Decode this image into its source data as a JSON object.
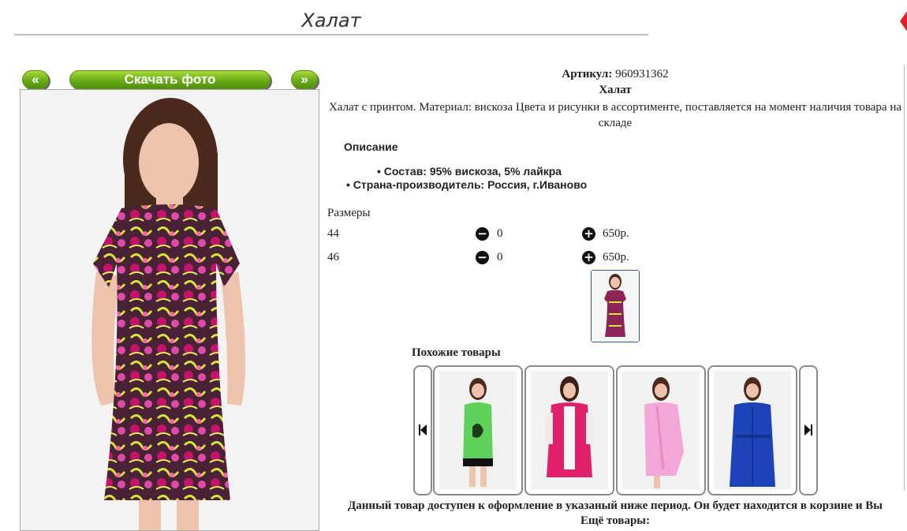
{
  "page_title": "Халат",
  "buttons": {
    "prev": "«",
    "download": "Скачать фото",
    "next": "»"
  },
  "product": {
    "sku_label": "Артикул:",
    "sku_value": "960931362",
    "name": "Халат",
    "description": "Халат с принтом. Материал: вискоза Цвета и рисунки в ассортименте, поставляется на момент наличия товара на складе"
  },
  "description_section": {
    "heading": "Описание",
    "features": [
      "Состав: 95% вискоза, 5% лайкра",
      "Страна-производитель: Россия, г.Иваново"
    ]
  },
  "sizes": {
    "heading": "Размеры",
    "rows": [
      {
        "size": "44",
        "qty": "0",
        "price": "650р."
      },
      {
        "size": "46",
        "qty": "0",
        "price": "650р."
      }
    ]
  },
  "similar": {
    "heading": "Похожие товары",
    "items": [
      {
        "icon": "green-dress-photo",
        "color": "#5fd05a"
      },
      {
        "icon": "pink-robe-photo",
        "color": "#e0206a"
      },
      {
        "icon": "light-pink-robe-photo",
        "color": "#f3a6d8"
      },
      {
        "icon": "blue-robe-photo",
        "color": "#1c44b8"
      }
    ]
  },
  "footer": {
    "availability": "Данный товар доступен к оформление в указаный ниже период. Он будет находится в корзине и Вы",
    "more": "Ещё товары:"
  },
  "colors": {
    "button_green": "#6aac17",
    "print_magenta": "#c4146a",
    "print_yellow": "#d7e53a"
  }
}
